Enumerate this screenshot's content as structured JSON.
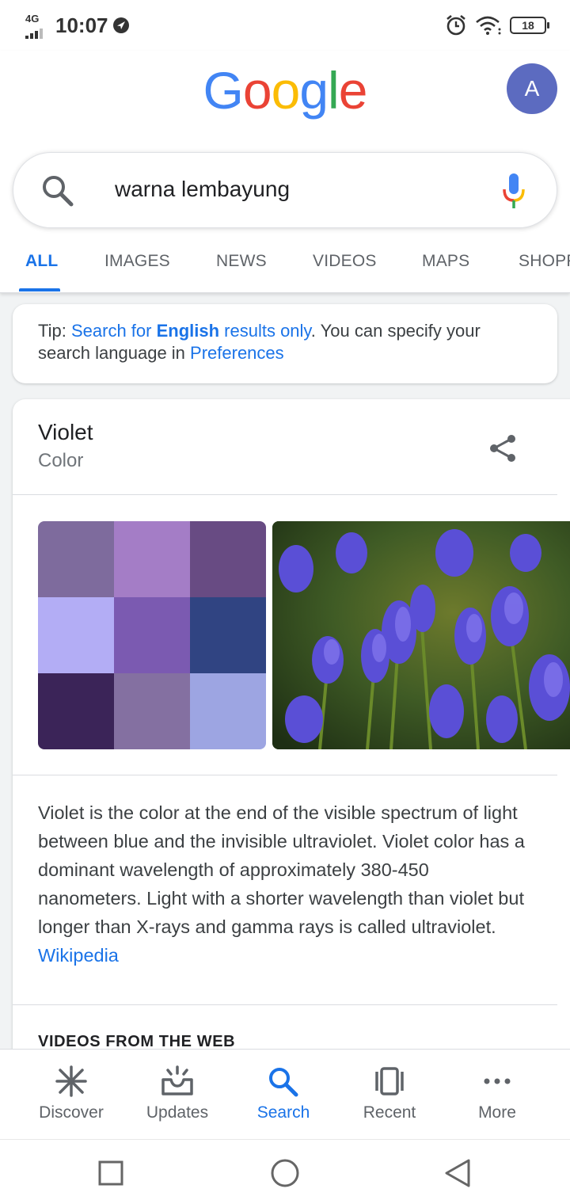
{
  "status_bar": {
    "network": "4G",
    "time": "10:07",
    "battery": "18"
  },
  "header": {
    "logo": [
      "G",
      "o",
      "o",
      "g",
      "l",
      "e"
    ],
    "logo_colors": [
      "#4285F4",
      "#EA4335",
      "#FBBC05",
      "#4285F4",
      "#34A853",
      "#EA4335"
    ],
    "avatar_initial": "A",
    "search_query": "warna lembayung",
    "tabs": [
      "ALL",
      "IMAGES",
      "NEWS",
      "VIDEOS",
      "MAPS",
      "SHOPP"
    ],
    "active_tab": "ALL"
  },
  "tip": {
    "prefix": "Tip: ",
    "link_before": "Search for ",
    "link_bold": "English",
    "link_after": " results only",
    "middle": ". You can specify your search language in ",
    "preferences": "Preferences"
  },
  "knowledge_panel": {
    "title": "Violet",
    "subtitle": "Color",
    "swatch_colors": [
      "#7e6b9d",
      "#a47dc6",
      "#684b83",
      "#b3adf5",
      "#7b5ab1",
      "#304482",
      "#3b2458",
      "#8470a1",
      "#9da5e2"
    ],
    "description": "Violet is the color at the end of the visible spectrum of light between blue and the invisible ultraviolet. Violet color has a dominant wavelength of approximately 380-450 nanometers. Light with a shorter wavelength than violet but longer than X-rays and gamma rays is called ultraviolet. ",
    "source_link": "Wikipedia",
    "section_heading": "VIDEOS FROM THE WEB"
  },
  "bottom_nav": [
    {
      "label": "Discover",
      "icon": "asterisk-icon"
    },
    {
      "label": "Updates",
      "icon": "updates-tray-icon"
    },
    {
      "label": "Search",
      "icon": "search-icon"
    },
    {
      "label": "Recent",
      "icon": "recent-cards-icon"
    },
    {
      "label": "More",
      "icon": "more-dots-icon"
    }
  ],
  "active_nav": "Search",
  "accent_color": "#1a73e8"
}
